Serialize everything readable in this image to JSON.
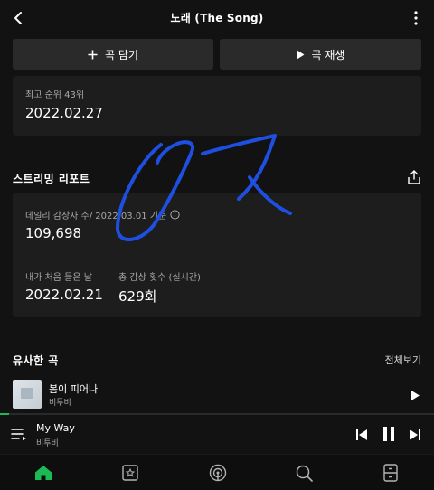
{
  "header": {
    "title": "노래 (The Song)",
    "back_icon": "chevron-left-icon",
    "more_icon": "more-vertical-icon"
  },
  "actions": {
    "add_label": "곡 담기",
    "add_icon": "plus-icon",
    "play_label": "곡 재생",
    "play_icon": "play-icon"
  },
  "peak": {
    "label": "최고 순위 43위",
    "date": "2022.02.27"
  },
  "streaming_report": {
    "title": "스트리밍 리포트",
    "daily_listeners_label": "데일리 감상자 수/ 2022.03.01 기준",
    "daily_listeners_value": "109,698",
    "first_listen_label": "내가 처음 들은 날",
    "first_listen_value": "2022.02.21",
    "total_plays_label": "총 감상 횟수 (실시간)",
    "total_plays_value": "629회"
  },
  "similar": {
    "title": "유사한 곡",
    "see_all": "전체보기",
    "tracks": [
      {
        "title": "봄이 피어나",
        "artist": "비투비"
      }
    ]
  },
  "now_playing": {
    "title": "My Way",
    "artist": "비투비",
    "progress": 0.02
  },
  "colors": {
    "accent": "#1db954",
    "background": "#121212",
    "card": "#1d1d1d",
    "scribble": "#1f4fe0"
  },
  "nav": {
    "items": [
      "home-icon",
      "library-icon",
      "podcast-icon",
      "search-icon",
      "storage-icon"
    ]
  }
}
